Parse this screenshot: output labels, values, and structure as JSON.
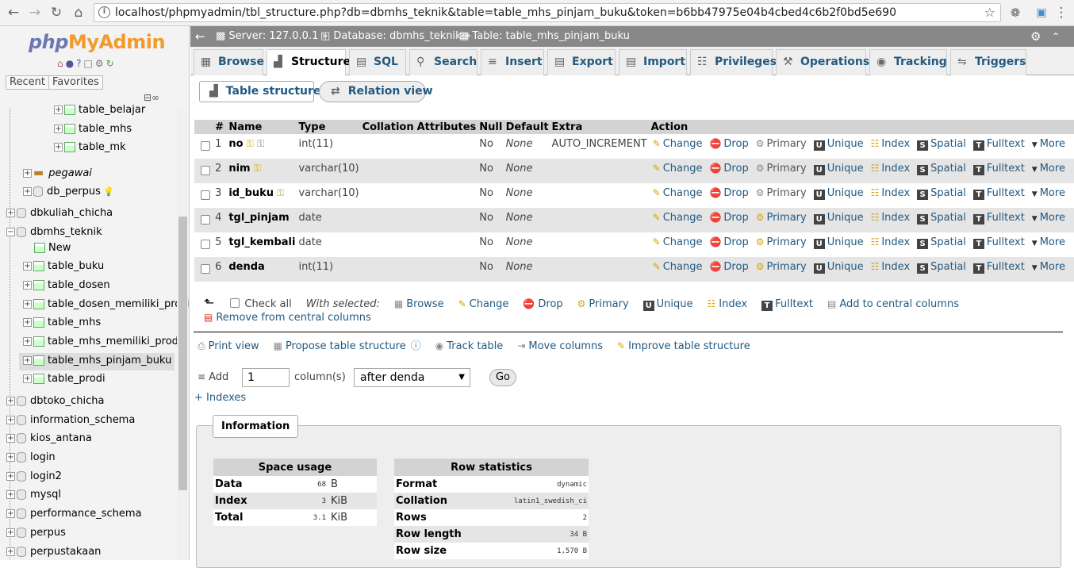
{
  "browser": {
    "url": "localhost/phpmyadmin/tbl_structure.php?db=dbmhs_teknik&table=table_mhs_pinjam_buku&token=b6bb47975e04b4cbed4c6b2f0bd5e690"
  },
  "sidebar": {
    "logo_php": "php",
    "logo_myadmin": "MyAdmin",
    "tabs": [
      "Recent",
      "Favorites"
    ],
    "tree": [
      {
        "label": "table_belajar",
        "type": "table",
        "level": 3
      },
      {
        "label": "table_mhs",
        "type": "table",
        "level": 3
      },
      {
        "label": "table_mk",
        "type": "table",
        "level": 3
      },
      {
        "label": "pegawai",
        "type": "db",
        "level": 1
      },
      {
        "label": "db_perpus",
        "type": "db",
        "level": 1
      },
      {
        "label": "dbkuliah_chicha",
        "type": "db",
        "level": 0
      },
      {
        "label": "dbmhs_teknik",
        "type": "db",
        "level": 0
      },
      {
        "label": "New",
        "type": "new",
        "level": 1
      },
      {
        "label": "table_buku",
        "type": "table",
        "level": 1
      },
      {
        "label": "table_dosen",
        "type": "table",
        "level": 1
      },
      {
        "label": "table_dosen_memiliki_prodi",
        "type": "table",
        "level": 1
      },
      {
        "label": "table_mhs",
        "type": "table",
        "level": 1
      },
      {
        "label": "table_mhs_memiliki_prodi",
        "type": "table",
        "level": 1
      },
      {
        "label": "table_mhs_pinjam_buku",
        "type": "table",
        "level": 1
      },
      {
        "label": "table_prodi",
        "type": "table",
        "level": 1
      },
      {
        "label": "dbtoko_chicha",
        "type": "db",
        "level": 0
      },
      {
        "label": "information_schema",
        "type": "db",
        "level": 0
      },
      {
        "label": "kios_antana",
        "type": "db",
        "level": 0
      },
      {
        "label": "login",
        "type": "db",
        "level": 0
      },
      {
        "label": "login2",
        "type": "db",
        "level": 0
      },
      {
        "label": "mysql",
        "type": "db",
        "level": 0
      },
      {
        "label": "performance_schema",
        "type": "db",
        "level": 0
      },
      {
        "label": "perpus",
        "type": "db",
        "level": 0
      },
      {
        "label": "perpustakaan",
        "type": "db",
        "level": 0
      }
    ]
  },
  "breadcrumb": {
    "server": "Server: 127.0.0.1",
    "database": "Database: dbmhs_teknik",
    "table": "Table: table_mhs_pinjam_buku"
  },
  "tabs": [
    "Browse",
    "Structure",
    "SQL",
    "Search",
    "Insert",
    "Export",
    "Import",
    "Privileges",
    "Operations",
    "Tracking",
    "Triggers"
  ],
  "subtabs": [
    "Table structure",
    "Relation view"
  ],
  "structure": {
    "headers": [
      "#",
      "Name",
      "Type",
      "Collation",
      "Attributes",
      "Null",
      "Default",
      "Extra",
      "Action"
    ],
    "rows": [
      {
        "num": "1",
        "name": "no",
        "type": "int(11)",
        "null": "No",
        "default": "None",
        "extra": "AUTO_INCREMENT"
      },
      {
        "num": "2",
        "name": "nim",
        "type": "varchar(10)",
        "null": "No",
        "default": "None",
        "extra": ""
      },
      {
        "num": "3",
        "name": "id_buku",
        "type": "varchar(10)",
        "null": "No",
        "default": "None",
        "extra": ""
      },
      {
        "num": "4",
        "name": "tgl_pinjam",
        "type": "date",
        "null": "No",
        "default": "None",
        "extra": ""
      },
      {
        "num": "5",
        "name": "tgl_kembali",
        "type": "date",
        "null": "No",
        "default": "None",
        "extra": ""
      },
      {
        "num": "6",
        "name": "denda",
        "type": "int(11)",
        "null": "No",
        "default": "None",
        "extra": ""
      }
    ],
    "actions": [
      "Change",
      "Drop",
      "Primary",
      "Unique",
      "Index",
      "Spatial",
      "Fulltext",
      "More"
    ]
  },
  "bulk": {
    "check_all": "Check all",
    "with_selected": "With selected:",
    "actions": [
      "Browse",
      "Change",
      "Drop",
      "Primary",
      "Unique",
      "Index",
      "Fulltext",
      "Add to central columns"
    ],
    "remove": "Remove from central columns"
  },
  "tools": [
    "Print view",
    "Propose table structure",
    "Track table",
    "Move columns",
    "Improve table structure"
  ],
  "add_columns": {
    "label": "Add",
    "count": "1",
    "unit": "column(s)",
    "position": "after denda",
    "go": "Go"
  },
  "indexes_link": "+ Indexes",
  "information": {
    "title": "Information",
    "space_usage": {
      "header": "Space usage",
      "rows": [
        {
          "label": "Data",
          "value": "68",
          "unit": "B"
        },
        {
          "label": "Index",
          "value": "3",
          "unit": "KiB"
        },
        {
          "label": "Total",
          "value": "3.1",
          "unit": "KiB"
        }
      ]
    },
    "row_statistics": {
      "header": "Row statistics",
      "rows": [
        {
          "label": "Format",
          "value": "dynamic"
        },
        {
          "label": "Collation",
          "value": "latin1_swedish_ci"
        },
        {
          "label": "Rows",
          "value": "2"
        },
        {
          "label": "Row length",
          "value": "34 B"
        },
        {
          "label": "Row size",
          "value": "1,570 B"
        }
      ]
    }
  }
}
